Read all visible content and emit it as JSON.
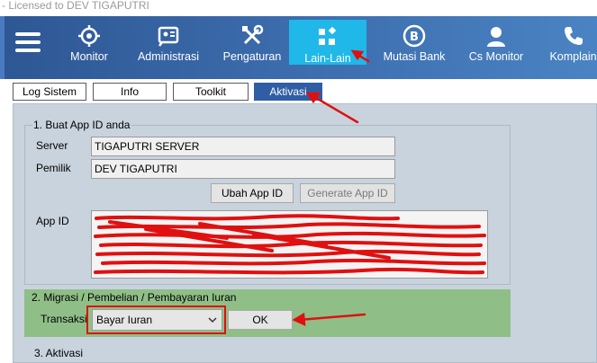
{
  "window": {
    "title": "- Licensed to DEV TIGAPUTRI"
  },
  "nav": {
    "items": [
      {
        "label": "Monitor",
        "icon": "crosshair-icon"
      },
      {
        "label": "Administrasi",
        "icon": "id-card-icon"
      },
      {
        "label": "Pengaturan",
        "icon": "tools-icon"
      },
      {
        "label": "Lain-Lain",
        "icon": "apps-icon"
      },
      {
        "label": "Mutasi Bank",
        "icon": "bitcoin-icon"
      },
      {
        "label": "Cs Monitor",
        "icon": "user-icon"
      },
      {
        "label": "Komplain",
        "icon": "phone-icon"
      }
    ],
    "active": "Lain-Lain",
    "active_color": "#1fb8e8"
  },
  "tabs": [
    "Log Sistem",
    "Info",
    "Toolkit",
    "Aktivasi"
  ],
  "active_tab": "Aktivasi",
  "section1": {
    "title": "1. Buat App ID anda",
    "server_label": "Server",
    "server_value": "TIGAPUTRI SERVER",
    "pemilik_label": "Pemilik",
    "pemilik_value": "DEV TIGAPUTRI",
    "ubah_button": "Ubah App ID",
    "generate_button": "Generate App ID",
    "appid_label": "App ID"
  },
  "section2": {
    "title": "2. Migrasi / Pembelian / Pembayaran Iuran",
    "transaksi_label": "Transaksi",
    "transaksi_value": "Bayar Iuran",
    "ok_button": "OK"
  },
  "section3": {
    "title": "3. Aktivasi"
  },
  "colors": {
    "toolbar": "#3e6fb0",
    "tab_active": "#2f5ea5",
    "panel": "#c8d3dd",
    "section2_bg": "#8fbf87",
    "annotation": "#e01010"
  }
}
